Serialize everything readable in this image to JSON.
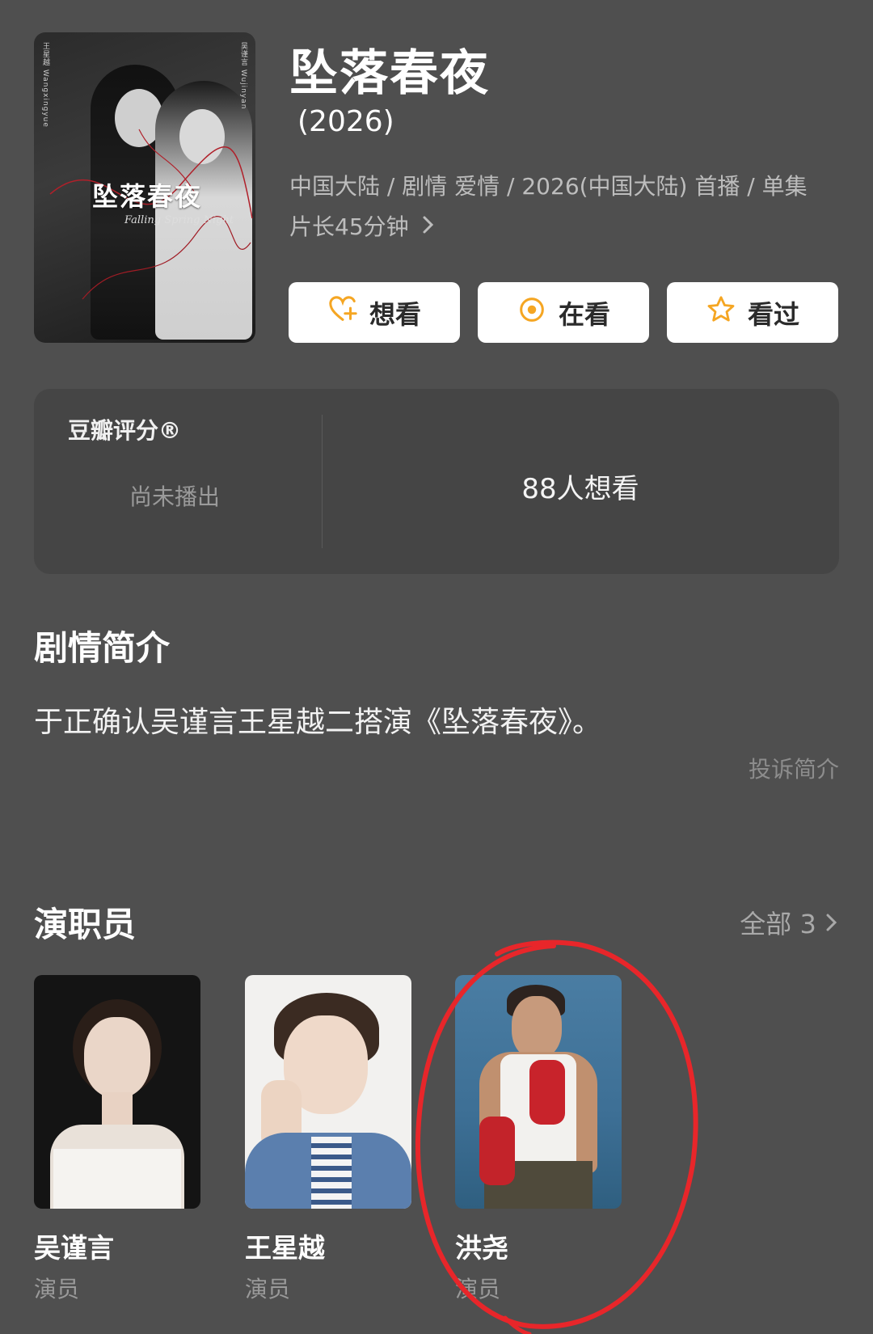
{
  "poster": {
    "title_art": "坠落春夜",
    "subtitle_art": "Falling Spring Night",
    "name_left": "王星越 Wangxingyue",
    "name_right": "吴谨言 Wujinyan"
  },
  "show": {
    "title": "坠落春夜",
    "year": "(2026)",
    "meta": "中国大陆 / 剧情 爱情 / 2026(中国大陆) 首播 / 单集片长45分钟"
  },
  "actions": {
    "want": "想看",
    "watching": "在看",
    "watched": "看过"
  },
  "rating": {
    "label": "豆瓣评分®",
    "status": "尚未播出",
    "want_count": "88人想看"
  },
  "synopsis": {
    "heading": "剧情简介",
    "text": "于正确认吴谨言王星越二搭演《坠落春夜》。",
    "report": "投诉简介"
  },
  "cast": {
    "heading": "演职员",
    "all_label": "全部 3",
    "members": [
      {
        "name": "吴谨言",
        "role": "演员"
      },
      {
        "name": "王星越",
        "role": "演员"
      },
      {
        "name": "洪尧",
        "role": "演员"
      }
    ]
  },
  "colors": {
    "background": "#4f4f4f",
    "card": "#454545",
    "accent_orange": "#f5a623",
    "annotation_red": "#e8262a"
  },
  "icons": {
    "want": "heart-plus-icon",
    "watching": "target-icon",
    "watched": "star-icon",
    "chevron": "chevron-right-icon"
  }
}
